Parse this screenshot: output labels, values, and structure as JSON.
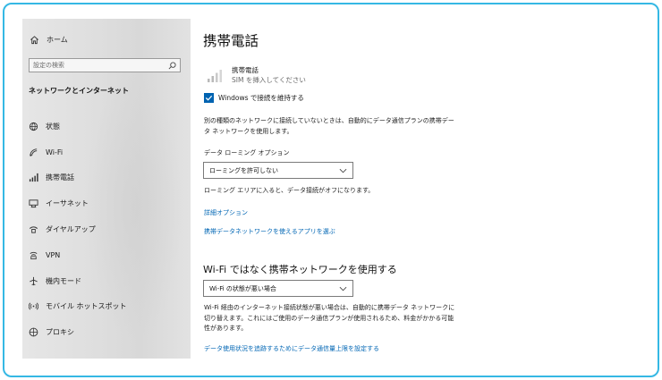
{
  "sidebar": {
    "home_label": "ホーム",
    "search_placeholder": "設定の検索",
    "section_title": "ネットワークとインターネット",
    "items": [
      {
        "label": "状態",
        "icon": "globe-status-icon"
      },
      {
        "label": "Wi-Fi",
        "icon": "wifi-icon"
      },
      {
        "label": "携帯電話",
        "icon": "cellular-icon"
      },
      {
        "label": "イーサネット",
        "icon": "ethernet-icon"
      },
      {
        "label": "ダイヤルアップ",
        "icon": "dialup-icon"
      },
      {
        "label": "VPN",
        "icon": "vpn-icon"
      },
      {
        "label": "機内モード",
        "icon": "airplane-icon"
      },
      {
        "label": "モバイル ホットスポット",
        "icon": "hotspot-icon"
      },
      {
        "label": "プロキシ",
        "icon": "globe-icon"
      }
    ]
  },
  "main": {
    "title": "携帯電話",
    "cell_name": "携帯電話",
    "cell_status": "SIM を挿入してください",
    "checkbox_label": "Windows で接続を維持する",
    "checkbox_checked": true,
    "desc1": "別の種類のネットワークに接続していないときは、自動的にデータ通信プランの携帯データ ネットワークを使用します。",
    "roaming_label": "データ ローミング オプション",
    "roaming_value": "ローミングを許可しない",
    "roaming_note": "ローミング エリアに入ると、データ接続がオフになります。",
    "link_advanced": "詳細オプション",
    "link_apps": "携帯データネットワークを使えるアプリを選ぶ",
    "section2_title": "Wi-Fi ではなく携帯ネットワークを使用する",
    "wifi_value": "Wi-Fi の状態が悪い場合",
    "desc2": "Wi-Fi 経由のインターネット接続状態が悪い場合は、自動的に携帯データ ネットワークに切り替えます。これにはご使用のデータ通信プランが使用されるため、料金がかかる可能性があります。",
    "link_limit": "データ使用状況を追跡するためにデータ通信量上限を設定する"
  },
  "colors": {
    "accent": "#0063b1",
    "link": "#0066b4",
    "frame": "#35b8e4"
  }
}
